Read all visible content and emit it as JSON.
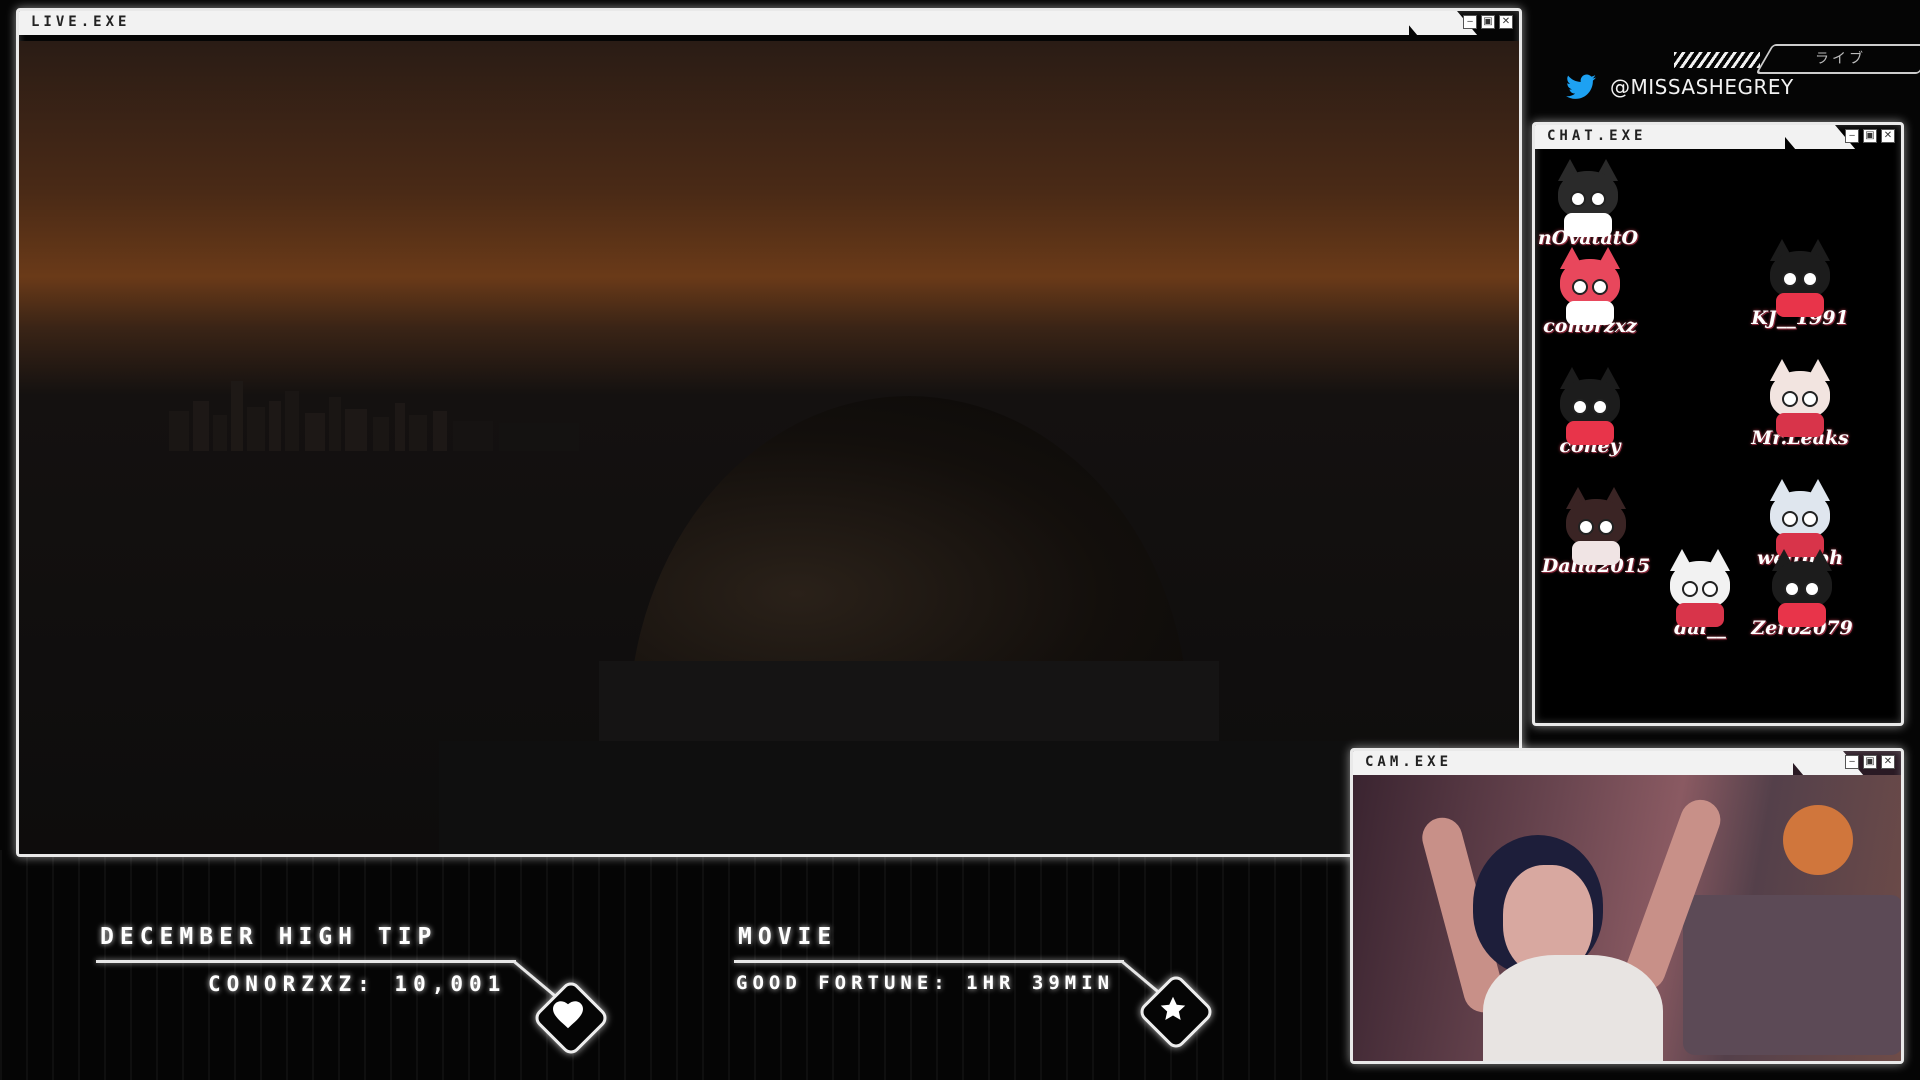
{
  "windows": {
    "live": {
      "title": "LIVE.EXE"
    },
    "chat": {
      "title": "CHAT.EXE"
    },
    "cam": {
      "title": "CAM.EXE"
    }
  },
  "window_buttons": {
    "minimize": "‒",
    "maximize": "▣",
    "close": "✕"
  },
  "social": {
    "icon": "twitter-bird-icon",
    "handle": "@MISSASHEGREY"
  },
  "top_tag": {
    "text": "ライブ"
  },
  "chatters": [
    {
      "name": "nOvatatO",
      "color": "#2a2a2a",
      "accent": "#ffffff"
    },
    {
      "name": "KJ__1991",
      "color": "#1c1c1c",
      "accent": "#e8344a"
    },
    {
      "name": "conorzxz",
      "color": "#e8475c",
      "accent": "#ffffff"
    },
    {
      "name": "Mr.Leaks",
      "color": "#f2e4e0",
      "accent": "#d8344a"
    },
    {
      "name": "coney",
      "color": "#1c1c1c",
      "accent": "#e8344a"
    },
    {
      "name": "weirdbh",
      "color": "#dfe6ee",
      "accent": "#d8344a"
    },
    {
      "name": "Dalia2015",
      "color": "#3a2424",
      "accent": "#f0e4e4"
    },
    {
      "name": "dai__",
      "color": "#f2f2f2",
      "accent": "#d8344a"
    },
    {
      "name": "Zero2079",
      "color": "#1c1c1c",
      "accent": "#e8344a"
    }
  ],
  "panels": {
    "tip": {
      "heading": "DECEMBER HIGH TIP",
      "value": "CONORZXZ: 10,001",
      "icon": "heart-icon"
    },
    "movie": {
      "heading": "MOVIE",
      "value": "GOOD FORTUNE: 1HR 39MIN",
      "icon": "star-icon"
    }
  }
}
